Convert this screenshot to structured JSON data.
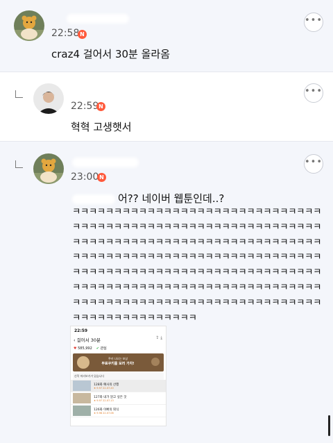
{
  "comments": [
    {
      "time": "22:58",
      "badge": "N",
      "text": "craz4 걸어서 30분 올라옴",
      "more": "•••"
    },
    {
      "time": "22:59",
      "badge": "N",
      "text": "혁혁 고생햇서",
      "more": "•••"
    },
    {
      "time": "23:00",
      "badge": "N",
      "text": "어?? 네이버 웹툰인데..?",
      "laugh": "ㅋㅋㅋㅋㅋㅋㅋㅋㅋㅋㅋㅋㅋㅋㅋㅋㅋㅋㅋㅋㅋㅋㅋㅋㅋㅋㅋㅋㅋㅋㅋㅋㅋㅋㅋㅋㅋㅋㅋㅋㅋㅋㅋㅋㅋㅋㅋㅋㅋㅋㅋㅋㅋㅋㅋㅋㅋㅋㅋㅋㅋㅋㅋㅋㅋㅋㅋㅋㅋㅋㅋㅋㅋㅋㅋㅋㅋㅋㅋㅋㅋㅋㅋㅋㅋㅋㅋㅋㅋㅋㅋㅋㅋㅋㅋㅋㅋㅋㅋㅋㅋㅋㅋㅋㅋㅋㅋㅋㅋㅋㅋㅋㅋㅋㅋㅋㅋㅋㅋㅋㅋㅋㅋㅋㅋㅋㅋㅋㅋㅋㅋㅋㅋㅋㅋㅋㅋㅋㅋㅋㅋㅋㅋㅋㅋㅋㅋㅋㅋㅋㅋㅋㅋㅋㅋㅋㅋㅋㅋㅋㅋㅋㅋㅋㅋㅋㅋㅋㅋㅋㅋㅋㅋㅋㅋㅋㅋㅋㅋㅋㅋㅋㅋㅋㅋㅋㅋㅋㅋㅋㅋㅋㅋㅋㅋㅋㅋㅋㅋㅋㅋㅋㅋㅋㅋㅋㅋㅋㅋㅋㅋㅋㅋㅋㅋㅋㅋㅋㅋㅋㅋㅋㅋㅋㅋ",
      "more": "•••"
    }
  ],
  "embedded_screenshot": {
    "status_time": "22:59",
    "title": "걸어서 30분",
    "back": "‹",
    "share_icon": "share-icon",
    "download_icon": "download-icon",
    "likes": "585,992",
    "interest": "관심",
    "banner_line1": "쿠키 나오는 보상",
    "banner_line2": "무료쿠키를 보러 가자!",
    "notice": "신작 미리보기가 있습니다",
    "episodes": [
      {
        "title": "128화 예사의 산행",
        "sub": "★ 9.97  22.07.20"
      },
      {
        "title": "127화 내가 알고 싶은 것",
        "sub": "★ 9.97  22.07.13"
      },
      {
        "title": "126화 이빠의 외식",
        "sub": "★ 9.98  22.07.06"
      }
    ]
  },
  "colors": {
    "badge": "#ff5a3c",
    "bg_alt": "#f4f6fb"
  }
}
